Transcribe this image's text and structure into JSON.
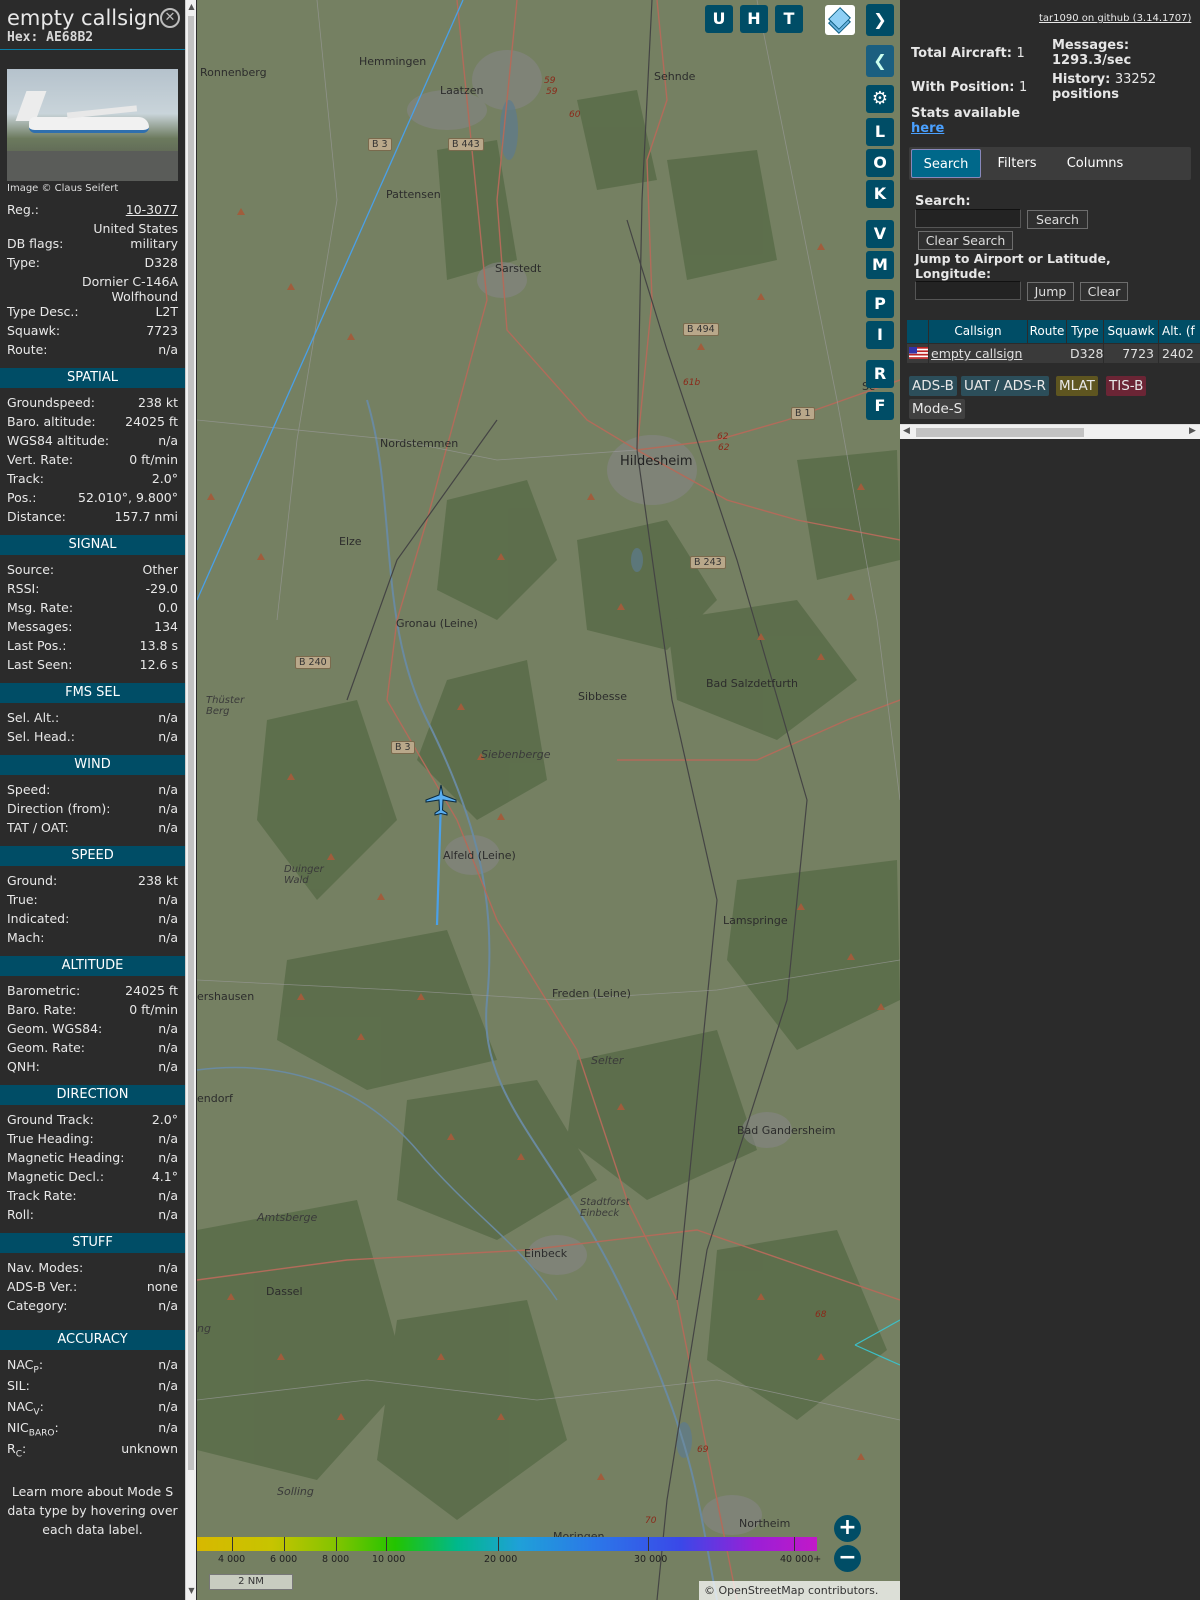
{
  "info": {
    "callsign": "empty callsign",
    "hex_label": "Hex: AE68B2",
    "photo_credit": "Image © Claus Seifert",
    "rows": [
      {
        "k": "Reg.:",
        "v": "10-3077",
        "link": true
      },
      {
        "full": "United States"
      },
      {
        "k": "DB flags:",
        "v": "military"
      },
      {
        "k": "Type:",
        "v": "D328"
      },
      {
        "full": "Dornier C-146A"
      },
      {
        "full": "Wolfhound"
      },
      {
        "k": "Type Desc.:",
        "v": "L2T"
      },
      {
        "k": "Squawk:",
        "v": "7723"
      },
      {
        "k": "Route:",
        "v": "n/a"
      }
    ],
    "sections": [
      {
        "title": "SPATIAL",
        "rows": [
          {
            "k": "Groundspeed:",
            "v": "238 kt"
          },
          {
            "k": "Baro. altitude:",
            "v": "24025 ft"
          },
          {
            "k": "WGS84 altitude:",
            "v": "n/a"
          },
          {
            "k": "Vert. Rate:",
            "v": "0 ft/min"
          },
          {
            "k": "Track:",
            "v": "2.0°"
          },
          {
            "k": "Pos.:",
            "v": "52.010°, 9.800°"
          },
          {
            "k": "Distance:",
            "v": "157.7 nmi"
          }
        ]
      },
      {
        "title": "SIGNAL",
        "rows": [
          {
            "k": "Source:",
            "v": "Other"
          },
          {
            "k": "RSSI:",
            "v": "-29.0"
          },
          {
            "k": "Msg. Rate:",
            "v": "0.0"
          },
          {
            "k": "Messages:",
            "v": "134"
          },
          {
            "k": "Last Pos.:",
            "v": "13.8 s"
          },
          {
            "k": "Last Seen:",
            "v": "12.6 s"
          }
        ]
      },
      {
        "title": "FMS SEL",
        "rows": [
          {
            "k": "Sel. Alt.:",
            "v": "n/a"
          },
          {
            "k": "Sel. Head.:",
            "v": "n/a"
          }
        ]
      },
      {
        "title": "WIND",
        "rows": [
          {
            "k": "Speed:",
            "v": "n/a"
          },
          {
            "k": "Direction (from):",
            "v": "n/a"
          },
          {
            "k": "TAT / OAT:",
            "v": "n/a"
          }
        ]
      },
      {
        "title": "SPEED",
        "rows": [
          {
            "k": "Ground:",
            "v": "238 kt"
          },
          {
            "k": "True:",
            "v": "n/a"
          },
          {
            "k": "Indicated:",
            "v": "n/a"
          },
          {
            "k": "Mach:",
            "v": "n/a"
          }
        ]
      },
      {
        "title": "ALTITUDE",
        "rows": [
          {
            "k": "Barometric:",
            "v": "24025 ft"
          },
          {
            "k": "Baro. Rate:",
            "v": "0 ft/min"
          },
          {
            "k": "Geom. WGS84:",
            "v": "n/a"
          },
          {
            "k": "Geom. Rate:",
            "v": "n/a"
          },
          {
            "k": "QNH:",
            "v": "n/a"
          }
        ]
      },
      {
        "title": "DIRECTION",
        "rows": [
          {
            "k": "Ground Track:",
            "v": "2.0°"
          },
          {
            "k": "True Heading:",
            "v": "n/a"
          },
          {
            "k": "Magnetic Heading:",
            "v": "n/a"
          },
          {
            "k": "Magnetic Decl.:",
            "v": "4.1°"
          },
          {
            "k": "Track Rate:",
            "v": "n/a"
          },
          {
            "k": "Roll:",
            "v": "n/a"
          }
        ]
      },
      {
        "title": "STUFF",
        "rows": [
          {
            "k": "Nav. Modes:",
            "v": "n/a"
          },
          {
            "k": "ADS-B Ver.:",
            "v": "none"
          },
          {
            "k": "Category:",
            "v": "n/a"
          }
        ]
      }
    ],
    "accuracy": {
      "title": "ACCURACY",
      "rows": [
        {
          "k": "NAC",
          "sub": "P",
          "v": "n/a"
        },
        {
          "k": "SIL:",
          "sub": "",
          "v": "n/a"
        },
        {
          "k": "NAC",
          "sub": "V",
          "v": "n/a"
        },
        {
          "k": "NIC",
          "sub": "BARO",
          "v": "n/a"
        },
        {
          "k": "R",
          "sub": "C",
          "v": "unknown"
        }
      ]
    },
    "learn_more": "Learn more about Mode S data type by hovering over each data label."
  },
  "map": {
    "towns": [
      {
        "name": "Ronnenberg",
        "cls": ""
      },
      {
        "name": "Hemmingen",
        "cls": ""
      },
      {
        "name": "Laatzen",
        "cls": ""
      },
      {
        "name": "Sehnde",
        "cls": ""
      },
      {
        "name": "Pattensen",
        "cls": ""
      },
      {
        "name": "Sarstedt",
        "cls": ""
      },
      {
        "name": "Nordstemmen",
        "cls": ""
      },
      {
        "name": "Hildesheim",
        "cls": "big"
      },
      {
        "name": "Elze",
        "cls": ""
      },
      {
        "name": "Gronau (Leine)",
        "cls": ""
      },
      {
        "name": "Bad Salzdetfurth",
        "cls": ""
      },
      {
        "name": "Sibbesse",
        "cls": ""
      },
      {
        "name": "Siebenberge",
        "cls": "it"
      },
      {
        "name": "Alfeld (Leine)",
        "cls": ""
      },
      {
        "name": "Duinger Wald",
        "cls": "it"
      },
      {
        "name": "Lamspringe",
        "cls": ""
      },
      {
        "name": "Freden (Leine)",
        "cls": ""
      },
      {
        "name": "ershausen",
        "cls": ""
      },
      {
        "name": "endorf",
        "cls": ""
      },
      {
        "name": "Selter",
        "cls": "it"
      },
      {
        "name": "Bad Gandersheim",
        "cls": ""
      },
      {
        "name": "Stadtforst Einbeck",
        "cls": "it"
      },
      {
        "name": "Amtsberge",
        "cls": "it"
      },
      {
        "name": "Einbeck",
        "cls": ""
      },
      {
        "name": "Dassel",
        "cls": ""
      },
      {
        "name": "Solling",
        "cls": "it"
      },
      {
        "name": "Moringen",
        "cls": ""
      },
      {
        "name": "Northeim",
        "cls": ""
      },
      {
        "name": "Thüster Berg",
        "cls": "it"
      },
      {
        "name": "Sc",
        "cls": ""
      },
      {
        "name": "ng",
        "cls": "it"
      }
    ],
    "shields": [
      "B 3",
      "B 443",
      "B 494",
      "B 1",
      "B 243",
      "B 240",
      "B 3"
    ],
    "road_numbers": [
      "59",
      "59",
      "60",
      "61b",
      "62",
      "62",
      "68",
      "69",
      "70"
    ],
    "toggle_buttons": [
      "U",
      "H",
      "T"
    ],
    "side_buttons": [
      "L",
      "O",
      "K",
      "V",
      "M",
      "P",
      "I",
      "R",
      "F"
    ],
    "altitude_scale": [
      "4 000",
      "6 000",
      "8 000",
      "10 000",
      "20 000",
      "30 000",
      "40 000+"
    ],
    "scale_bar": "2 NM",
    "osm_credit": "© OpenStreetMap contributors.",
    "icons": {
      "layers": "layers-icon",
      "next": "chevron-right-icon",
      "prev": "chevron-left-icon",
      "expand": "expand-horizontal-icon",
      "settings": "gear-icon",
      "zoom_in": "plus-icon",
      "zoom_out": "minus-icon",
      "aircraft": "aircraft-icon"
    },
    "track_color": "#4aa0e8"
  },
  "right": {
    "github_link": "tar1090 on github (3.14.1707)",
    "total_aircraft_label": "Total Aircraft:",
    "total_aircraft": "1",
    "with_position_label": "With Position:",
    "with_position": "1",
    "stats_label": "Stats available",
    "stats_link": "here",
    "messages_label": "Messages:",
    "messages_value": "1293.3/sec",
    "history_label": "History:",
    "history_value": "33252",
    "history_unit": "positions",
    "tabs": [
      "Search",
      "Filters",
      "Columns"
    ],
    "search_label": "Search:",
    "search_button": "Search",
    "clear_search_button": "Clear Search",
    "jump_label": "Jump to Airport or Latitude, Longitude:",
    "jump_button": "Jump",
    "clear_button": "Clear",
    "table": {
      "headers": [
        "",
        "Callsign",
        "Route",
        "Type",
        "Squawk",
        "Alt. (f"
      ],
      "row": {
        "callsign": "empty callsign",
        "route": "",
        "type": "D328",
        "squawk": "7723",
        "alt": "2402"
      }
    },
    "source_tags": [
      {
        "label": "ADS-B",
        "color": "#2c4e5a"
      },
      {
        "label": "UAT / ADS-R",
        "color": "#2c4e5a"
      },
      {
        "label": "MLAT",
        "color": "#5e5520"
      },
      {
        "label": "TIS-B",
        "color": "#6b2535"
      },
      {
        "label": "Mode-S",
        "color": "#404040"
      }
    ],
    "accent_color": "#004d66"
  }
}
